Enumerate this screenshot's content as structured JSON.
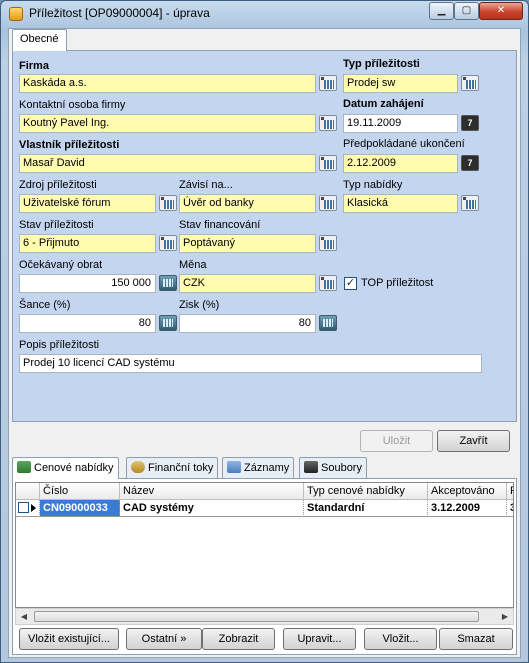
{
  "window": {
    "title": "Příležitost [OP09000004] - úprava",
    "controls": {
      "minimize": "▁",
      "maximize": "▢",
      "close": "✕"
    }
  },
  "tabs_top": [
    "Obecné"
  ],
  "form": {
    "firma": {
      "label": "Firma",
      "value": "Kaskáda a.s."
    },
    "kontakt": {
      "label": "Kontaktní osoba firmy",
      "value": "Koutný  Pavel Ing."
    },
    "vlastnik": {
      "label": "Vlastník příležitosti",
      "value": "Masař David"
    },
    "zdroj": {
      "label": "Zdroj příležitosti",
      "value": "Uživatelské fórum"
    },
    "zavisi": {
      "label": "Závisí na...",
      "value": "Úvěr od banky"
    },
    "stav": {
      "label": "Stav příležitosti",
      "value": "6 - Přijmuto"
    },
    "financovani": {
      "label": "Stav financování",
      "value": "Poptávaný"
    },
    "obrat": {
      "label": "Očekávaný obrat",
      "value": "150 000"
    },
    "mena": {
      "label": "Měna",
      "value": "CZK"
    },
    "sance": {
      "label": "Šance (%)",
      "value": "80"
    },
    "zisk": {
      "label": "Zisk (%)",
      "value": "80"
    },
    "popis": {
      "label": "Popis příležitosti",
      "value": "Prodej 10 licencí CAD systému"
    },
    "typ": {
      "label": "Typ příležitosti",
      "value": "Prodej sw"
    },
    "datum": {
      "label": "Datum zahájení",
      "value": "19.11.2009"
    },
    "ukonceni": {
      "label": "Předpokládané ukončení",
      "value": "2.12.2009"
    },
    "nabidka": {
      "label": "Typ nabídky",
      "value": "Klasická"
    },
    "top": {
      "label": "TOP příležitost",
      "checked": true
    }
  },
  "cal_glyph": "7",
  "check_glyph": "✓",
  "buttons": {
    "ulozit": "Uložit",
    "zavrit": "Zavřít"
  },
  "tabs_bottom": [
    "Cenové nabídky",
    "Finanční toky",
    "Záznamy",
    "Soubory"
  ],
  "grid": {
    "columns": [
      "Číslo",
      "Název",
      "Typ cenové nabídky",
      "Akceptováno",
      "P"
    ],
    "rows": [
      {
        "cislo": "CN09000033",
        "nazev": "CAD systémy",
        "typ": "Standardní",
        "akceptovano": "3.12.2009",
        "p": "3"
      }
    ]
  },
  "scroll": {
    "left": "◀",
    "right": "▶"
  },
  "actions": [
    "Vložit existující...",
    "Ostatní »",
    "Zobrazit",
    "Upravit...",
    "Vložit...",
    "Smazat"
  ],
  "colors": {
    "required_field": "#fffcb0",
    "panel": "#c4d6ef",
    "selected": "#3a7bd5"
  }
}
